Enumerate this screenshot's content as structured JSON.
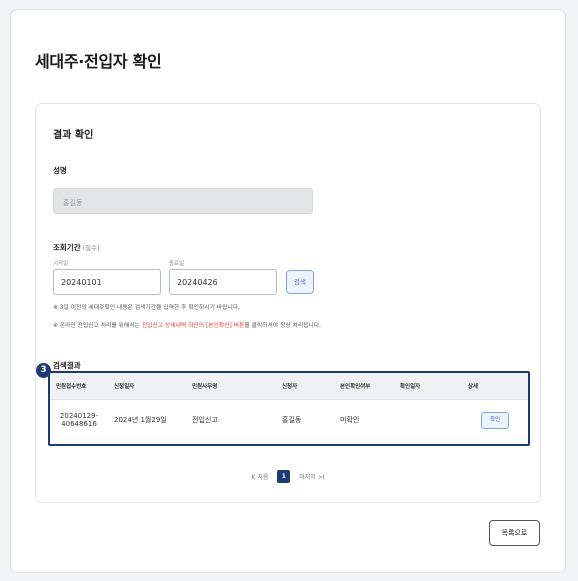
{
  "page": {
    "title": "세대주·전입자 확인"
  },
  "result_section": {
    "title": "결과 확인"
  },
  "name": {
    "label": "성명",
    "value": "홍길동"
  },
  "period": {
    "label": "조회기간",
    "required": "(필수)",
    "start_label": "시작일",
    "start_value": "20240101",
    "end_label": "종료일",
    "end_value": "20240426",
    "search_button": "검색"
  },
  "notes": {
    "note1": "※ 3일 이전의 세대주확인 내용은 검색기간을 입력한 후 확인하시기 바랍니다.",
    "note2_prefix": "※ 온라인 전입신고 처리를 위해서는 ",
    "note2_highlight": "전입신고 상세내역 하단의 [본인확인] 버튼",
    "note2_suffix": "을 클릭하셔야 정상 처리됩니다."
  },
  "results": {
    "title": "검색결과",
    "callout": "3",
    "columns": [
      "민원접수번호",
      "신청일자",
      "민원사무명",
      "신청자",
      "본인확인여부",
      "확인일자",
      "상세"
    ],
    "rows": [
      {
        "receipt_line1": "20240129-",
        "receipt_line2": "40648616",
        "date": "2024년 1월29일",
        "service": "전입신고",
        "applicant": "홍길동",
        "verified": "미확인",
        "confirm_date": "",
        "detail_button": "확인"
      }
    ]
  },
  "pagination": {
    "first": "K 처음",
    "current": "1",
    "last": "마지막 >I"
  },
  "list_button": "목록으로",
  "colors": {
    "accent": "#1e3a73",
    "link_blue": "#3b6fd6",
    "warning_red": "#e23b3b"
  }
}
